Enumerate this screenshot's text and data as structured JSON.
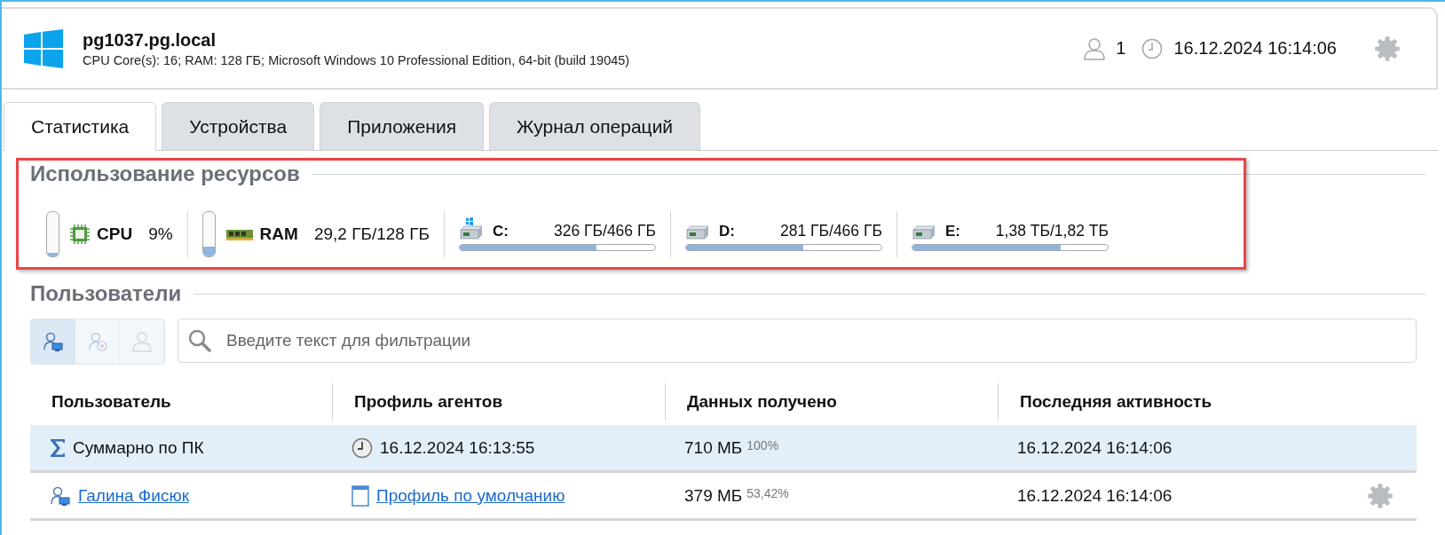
{
  "host": {
    "name": "pg1037.pg.local",
    "details": "CPU Core(s): 16; RAM: 128 ГБ; Microsoft Windows 10 Professional Edition, 64-bit (build 19045)"
  },
  "header": {
    "users_count": "1",
    "datetime": "16.12.2024 16:14:06"
  },
  "tabs": [
    {
      "label": "Статистика",
      "selected": true
    },
    {
      "label": "Устройства",
      "selected": false
    },
    {
      "label": "Приложения",
      "selected": false
    },
    {
      "label": "Журнал операций",
      "selected": false
    }
  ],
  "resources": {
    "title": "Использование ресурсов",
    "highlighted": true,
    "meters": [
      {
        "kind": "cpu",
        "label": "CPU",
        "reading": "9%",
        "level": 0.09
      },
      {
        "kind": "ram",
        "label": "RAM",
        "reading": "29,2 ГБ/128 ГБ",
        "level": 0.23
      },
      {
        "kind": "drive",
        "label": "C:",
        "reading": "326 ГБ/466 ГБ",
        "level": 0.7,
        "system": true
      },
      {
        "kind": "drive",
        "label": "D:",
        "reading": "281 ГБ/466 ГБ",
        "level": 0.6,
        "system": false
      },
      {
        "kind": "drive",
        "label": "E:",
        "reading": "1,38 ТБ/1,82 ТБ",
        "level": 0.76,
        "system": false
      }
    ]
  },
  "users": {
    "title": "Пользователи",
    "filters": [
      {
        "kind": "computer-user",
        "selected": true
      },
      {
        "kind": "remote-user",
        "selected": false
      },
      {
        "kind": "plain-user",
        "selected": false
      }
    ],
    "search": {
      "placeholder": "Введите текст для фильтрации"
    },
    "columns": [
      "Пользователь",
      "Профиль агентов",
      "Данных получено",
      "Последняя активность"
    ],
    "rows": [
      {
        "kind": "total",
        "selected": true,
        "user": "Суммарно по ПК",
        "profile": "16.12.2024 16:13:55",
        "data": "710 МБ",
        "share": "100%",
        "last": "16.12.2024 16:14:06"
      },
      {
        "kind": "user",
        "selected": false,
        "user": "Галина Фисюк",
        "profile": "Профиль по умолчанию",
        "data": "379 МБ",
        "share": "53,42%",
        "last": "16.12.2024 16:14:06"
      }
    ]
  }
}
